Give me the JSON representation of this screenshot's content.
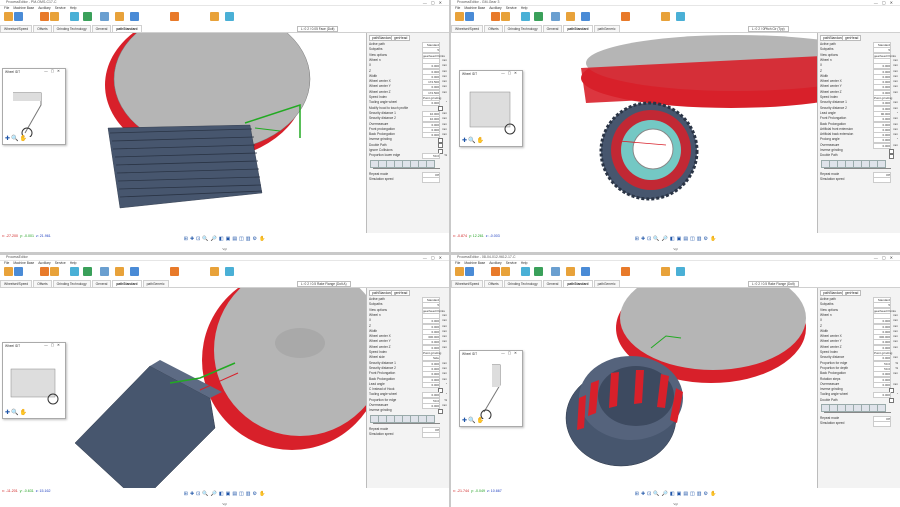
{
  "colors": {
    "panel_bg": "#f3f3f3",
    "wheel_red": "#d8202a",
    "wheel_gray": "#b5b5b5",
    "tool_blue": "#47566e",
    "cyan": "#74c8c4",
    "green": "#22aa22",
    "accent": "#1f55a8"
  },
  "quadrants": [
    {
      "title": "ProcessEditor - PM-OMS-C17-C",
      "viewport_label": "L: 0 2 / 0.05 Face (Dolt)",
      "tabs": [
        "Wheelset/Speed",
        "Offsets",
        "Grinding Technology",
        "General",
        "pathStandard"
      ],
      "panel_tabs": [
        "pathStandard",
        "genHead"
      ],
      "mini_title": "Wheel IDT",
      "coords": {
        "x": "x: -27.200",
        "y": "y: -0.001",
        "z": "z: 21.961"
      },
      "footer": "Vgl",
      "rows": [
        {
          "label": "Active path",
          "value": "Standard",
          "unit": ""
        },
        {
          "label": "Subpaths",
          "value": "5",
          "unit": ""
        },
        {
          "label": "View options",
          "value": "gearhead Points",
          "unit": ""
        },
        {
          "label": "Wheel n",
          "value": "",
          "unit": "mm"
        },
        {
          "label": "X",
          "value": "0.000",
          "unit": "mm"
        },
        {
          "label": "Z",
          "value": "0.000",
          "unit": "mm"
        },
        {
          "label": "Width",
          "value": "0.000",
          "unit": "mm"
        },
        {
          "label": "Wheel center X",
          "value": "172.500",
          "unit": "mm"
        },
        {
          "label": "Wheel center Y",
          "value": "0.000",
          "unit": "mm"
        },
        {
          "label": "Wheel center Z",
          "value": "172.500",
          "unit": "mm"
        },
        {
          "label": "Speed Index",
          "value": "Point grinding",
          "unit": ""
        },
        {
          "label": "Tooling angle wheel",
          "value": "0.000",
          "unit": "°"
        },
        {
          "label": "Modify hood to touch profile",
          "value": "",
          "unit": ""
        },
        {
          "label": "Security distance 1",
          "value": "10.000",
          "unit": "mm"
        },
        {
          "label": "Security distance 2",
          "value": "10.000",
          "unit": "mm"
        },
        {
          "label": "Overmeasure",
          "value": "0.000",
          "unit": "mm"
        },
        {
          "label": "Front prolongation",
          "value": "0.000",
          "unit": "mm"
        },
        {
          "label": "Back Prolongation",
          "value": "0.000",
          "unit": "mm"
        },
        {
          "label": "Inverse grinding",
          "value": "",
          "unit": ""
        },
        {
          "label": "Double Path",
          "value": "",
          "unit": ""
        },
        {
          "label": "Ignore Collisions",
          "value": "",
          "unit": ""
        },
        {
          "label": "Proportion lower edge",
          "value": "50.0",
          "unit": "%"
        },
        {
          "label": "Repeat mode",
          "value": "Off",
          "unit": ""
        },
        {
          "label": "Simulation speed",
          "value": "",
          "unit": ""
        }
      ]
    },
    {
      "title": "ProcessEditor - GM-Gear 3",
      "viewport_label": "L: 0 2 / 0Pitch Cir (Typ)",
      "tabs": [
        "Wheelset/Speed",
        "Offsets",
        "Grinding Technology",
        "General",
        "pathStandard",
        "pathGeneric"
      ],
      "panel_tabs": [
        "pathStandard",
        "genHead"
      ],
      "mini_title": "Wheel IDT",
      "coords": {
        "x": "x: -0.874",
        "y": "y: 12.261",
        "z": "z: -0.003"
      },
      "footer": "Vgl",
      "rows": [
        {
          "label": "Active path",
          "value": "Standard",
          "unit": ""
        },
        {
          "label": "Subpaths",
          "value": "5",
          "unit": ""
        },
        {
          "label": "View options",
          "value": "gearhead Points",
          "unit": ""
        },
        {
          "label": "Wheel n",
          "value": "",
          "unit": "mm"
        },
        {
          "label": "X",
          "value": "0.000",
          "unit": "mm"
        },
        {
          "label": "Z",
          "value": "0.000",
          "unit": "mm"
        },
        {
          "label": "Width",
          "value": "0.000",
          "unit": "mm"
        },
        {
          "label": "Wheel center X",
          "value": "0.000",
          "unit": "mm"
        },
        {
          "label": "Wheel center Y",
          "value": "0.000",
          "unit": "mm"
        },
        {
          "label": "Wheel center Z",
          "value": "0.000",
          "unit": "mm"
        },
        {
          "label": "Speed Index",
          "value": "Point grinding",
          "unit": ""
        },
        {
          "label": "Security distance 1",
          "value": "0.000",
          "unit": "mm"
        },
        {
          "label": "Security distance 2",
          "value": "0.000",
          "unit": "mm"
        },
        {
          "label": "Lead angle",
          "value": "90.000",
          "unit": "°"
        },
        {
          "label": "Front Prolongation",
          "value": "0.000",
          "unit": "mm"
        },
        {
          "label": "Back Prolongation",
          "value": "0.000",
          "unit": "mm"
        },
        {
          "label": "Artificial front extension",
          "value": "0.000",
          "unit": "mm"
        },
        {
          "label": "Artificial back extension",
          "value": "0.000",
          "unit": "mm"
        },
        {
          "label": "Prolong angle",
          "value": "0.000",
          "unit": "°"
        },
        {
          "label": "Overmeasure",
          "value": "0.000",
          "unit": "mm"
        },
        {
          "label": "Inverse grinding",
          "value": "",
          "unit": ""
        },
        {
          "label": "Double Path",
          "value": "",
          "unit": ""
        },
        {
          "label": "Repeat mode",
          "value": "Off",
          "unit": ""
        },
        {
          "label": "Simulation speed",
          "value": "",
          "unit": ""
        }
      ]
    },
    {
      "title": "ProcessEditor",
      "viewport_label": "L: 0 2 / 0.5 Rake Flange (Dolt A)",
      "tabs": [
        "Wheelset/Speed",
        "Offsets",
        "Grinding Technology",
        "General",
        "pathStandard",
        "pathGeneric"
      ],
      "panel_tabs": [
        "pathStandard",
        "genHead"
      ],
      "mini_title": "Wheel IDT",
      "coords": {
        "x": "x: -11.201",
        "y": "y: -0.631",
        "z": "z: 15.162"
      },
      "footer": "Vgl",
      "rows": [
        {
          "label": "Active path",
          "value": "Standard",
          "unit": ""
        },
        {
          "label": "Subpaths",
          "value": "5",
          "unit": ""
        },
        {
          "label": "View options",
          "value": "gearhead Points",
          "unit": ""
        },
        {
          "label": "Wheel n",
          "value": "",
          "unit": "mm"
        },
        {
          "label": "X",
          "value": "0.000",
          "unit": "mm"
        },
        {
          "label": "Z",
          "value": "0.000",
          "unit": "mm"
        },
        {
          "label": "Width",
          "value": "0.000",
          "unit": "mm"
        },
        {
          "label": "Wheel center X",
          "value": "300.000",
          "unit": "mm"
        },
        {
          "label": "Wheel center Y",
          "value": "0.000",
          "unit": "mm"
        },
        {
          "label": "Wheel center Z",
          "value": "0.000",
          "unit": "mm"
        },
        {
          "label": "Speed Index",
          "value": "Point grinding",
          "unit": ""
        },
        {
          "label": "Wheel side",
          "value": "Side",
          "unit": ""
        },
        {
          "label": "Security distance 1",
          "value": "0.000",
          "unit": "mm"
        },
        {
          "label": "Security distance 2",
          "value": "0.000",
          "unit": "mm"
        },
        {
          "label": "Front Prolongation",
          "value": "0.000",
          "unit": "mm"
        },
        {
          "label": "Back Prolongation",
          "value": "0.000",
          "unit": "mm"
        },
        {
          "label": "Lead angle",
          "value": "0.000",
          "unit": "°"
        },
        {
          "label": "C Instead of Hook",
          "value": "",
          "unit": ""
        },
        {
          "label": "Tooling angle wheel",
          "value": "0.000",
          "unit": "°"
        },
        {
          "label": "Proportion for edge",
          "value": "50.0",
          "unit": "%"
        },
        {
          "label": "Overmeasure",
          "value": "0.000",
          "unit": "mm"
        },
        {
          "label": "Inverse grinding",
          "value": "",
          "unit": ""
        },
        {
          "label": "Repeat mode",
          "value": "Off",
          "unit": ""
        },
        {
          "label": "Simulation speed",
          "value": "",
          "unit": ""
        }
      ]
    },
    {
      "title": "ProcessEditor - 08-04-012-9612-17-C",
      "viewport_label": "L: 0 2 / 0.5 Rake Flange (Dolt)",
      "tabs": [
        "Wheelset/Speed",
        "Offsets",
        "Grinding Technology",
        "General",
        "pathStandard",
        "pathGeneric"
      ],
      "panel_tabs": [
        "pathStandard",
        "genHead"
      ],
      "mini_title": "Wheel IDT",
      "coords": {
        "x": "x: -21.744",
        "y": "y: -0.049",
        "z": "z: 10.667"
      },
      "footer": "Vgl",
      "rows": [
        {
          "label": "Active path",
          "value": "Standard",
          "unit": ""
        },
        {
          "label": "Subpaths",
          "value": "5",
          "unit": ""
        },
        {
          "label": "View options",
          "value": "gearhead Points",
          "unit": ""
        },
        {
          "label": "Wheel n",
          "value": "",
          "unit": "mm"
        },
        {
          "label": "X",
          "value": "0.000",
          "unit": "mm"
        },
        {
          "label": "Z",
          "value": "0.000",
          "unit": "mm"
        },
        {
          "label": "Width",
          "value": "0.000",
          "unit": "mm"
        },
        {
          "label": "Wheel center X",
          "value": "300.000",
          "unit": "mm"
        },
        {
          "label": "Wheel center Y",
          "value": "0.000",
          "unit": "mm"
        },
        {
          "label": "Wheel center Z",
          "value": "0.000",
          "unit": "mm"
        },
        {
          "label": "Speed Index",
          "value": "Point grinding",
          "unit": ""
        },
        {
          "label": "Security distance",
          "value": "0.000",
          "unit": "mm"
        },
        {
          "label": "Proportion for edge",
          "value": "50.0",
          "unit": "%"
        },
        {
          "label": "Proportion for depth",
          "value": "50.0",
          "unit": "%"
        },
        {
          "label": "Back Prolongation",
          "value": "0.000",
          "unit": "mm"
        },
        {
          "label": "Rotation steps",
          "value": "0.000",
          "unit": ""
        },
        {
          "label": "Overmeasure",
          "value": "0.000",
          "unit": "mm"
        },
        {
          "label": "Inverse grinding",
          "value": "",
          "unit": ""
        },
        {
          "label": "Tooling angle wheel",
          "value": "0.000",
          "unit": "°"
        },
        {
          "label": "Double Path",
          "value": "",
          "unit": ""
        },
        {
          "label": "Repeat mode",
          "value": "Off",
          "unit": ""
        },
        {
          "label": "Simulation speed",
          "value": "",
          "unit": ""
        }
      ]
    }
  ],
  "menu": [
    "File",
    "Machine Base",
    "Auxiliary",
    "Service",
    "Help"
  ]
}
